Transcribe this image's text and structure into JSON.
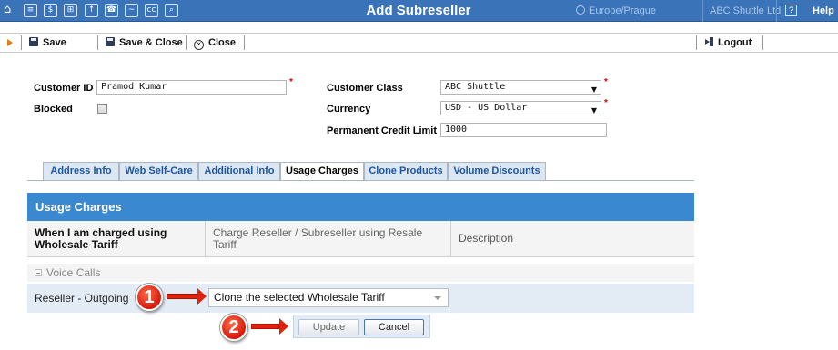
{
  "header": {
    "title": "Add Subreseller",
    "timezone": "Europe/Prague",
    "company": "ABC Shuttle Ltd",
    "help": "Help",
    "help_box": "?",
    "icons": [
      "home-icon",
      "list-icon",
      "dollar-icon",
      "grid-icon",
      "upload-icon",
      "phone-icon",
      "chart-icon",
      "cc-icon",
      "search-icon"
    ]
  },
  "toolbar": {
    "save": "Save",
    "save_close": "Save & Close",
    "close": "Close",
    "logout": "Logout"
  },
  "form": {
    "customer_id_label": "Customer ID",
    "customer_id_value": "Pramod Kumar",
    "blocked_label": "Blocked",
    "blocked_checked": false,
    "customer_class_label": "Customer Class",
    "customer_class_value": "ABC Shuttle",
    "currency_label": "Currency",
    "currency_value": "USD - US Dollar",
    "credit_limit_label": "Permanent Credit Limit",
    "credit_limit_value": "1000",
    "required_mark": "*"
  },
  "tabs": [
    {
      "label": "Address Info",
      "active": false
    },
    {
      "label": "Web Self-Care",
      "active": false
    },
    {
      "label": "Additional Info",
      "active": false
    },
    {
      "label": "Usage Charges",
      "active": true
    },
    {
      "label": "Clone Products",
      "active": false
    },
    {
      "label": "Volume Discounts",
      "active": false
    }
  ],
  "usage": {
    "panel_title": "Usage Charges",
    "col1": "When I am charged using Wholesale Tariff",
    "col2": "Charge Reseller / Subreseller using Resale Tariff",
    "col3": "Description",
    "group": "Voice Calls",
    "row_label": "Reseller - Outgoing",
    "row_value": "Clone the selected Wholesale Tariff",
    "update_btn": "Update",
    "cancel_btn": "Cancel"
  },
  "callouts": [
    "1",
    "2"
  ],
  "colors": {
    "header_bg": "#3a73b7",
    "panel_head": "#3a88cf",
    "row_bg": "#e3ebf4",
    "tab_link": "#1c55a3",
    "callout": "#d8180a"
  }
}
